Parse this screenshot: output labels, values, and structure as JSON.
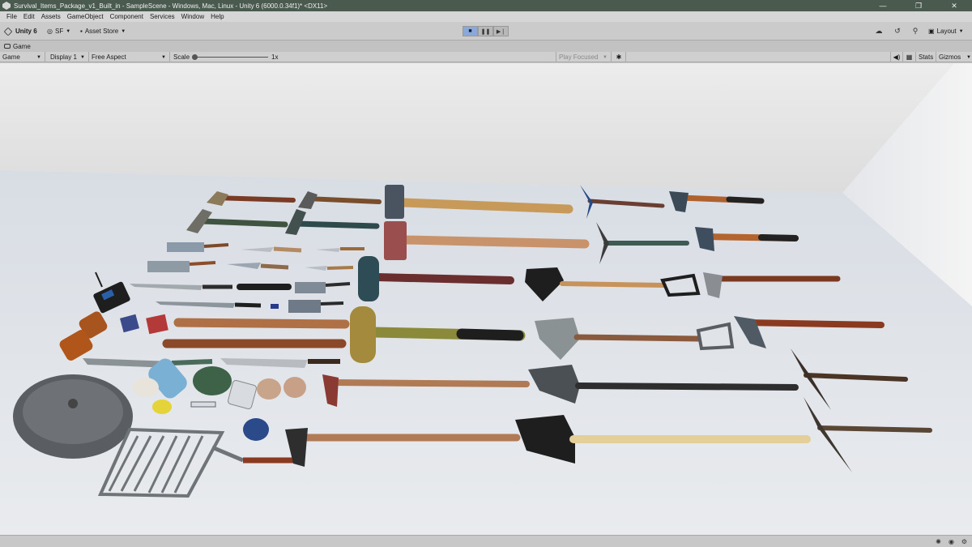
{
  "window": {
    "title": "Survival_Items_Package_v1_Built_in - SampleScene - Windows, Mac, Linux - Unity 6 (6000.0.34f1)* <DX11>",
    "minimize": "—",
    "maximize": "❐",
    "close": "✕"
  },
  "menu": [
    "File",
    "Edit",
    "Assets",
    "GameObject",
    "Component",
    "Services",
    "Window",
    "Help"
  ],
  "toolbar": {
    "unity_label": "Unity 6",
    "account_label": "SF",
    "asset_store_label": "Asset Store",
    "layout_label": "Layout",
    "play_active": "stop-play",
    "accent": "#8aa8d8"
  },
  "game_tab": {
    "label": "Game"
  },
  "game_bar": {
    "mode": "Game",
    "display": "Display 1",
    "aspect": "Free Aspect",
    "scale_label": "Scale",
    "scale_value": "1x",
    "play_focus": "Play Focused",
    "stats": "Stats",
    "gizmos": "Gizmos"
  },
  "scene": {
    "description_items": [
      "claw-hammer",
      "claw-hammer",
      "sledgehammer",
      "pickaxe",
      "hatchet",
      "knife",
      "cleaver",
      "machete",
      "baseball-bat",
      "shovel",
      "axe",
      "walkie-talkie",
      "can",
      "bottle",
      "canteen",
      "pot",
      "grill-grate",
      "mug",
      "flashlight"
    ]
  }
}
